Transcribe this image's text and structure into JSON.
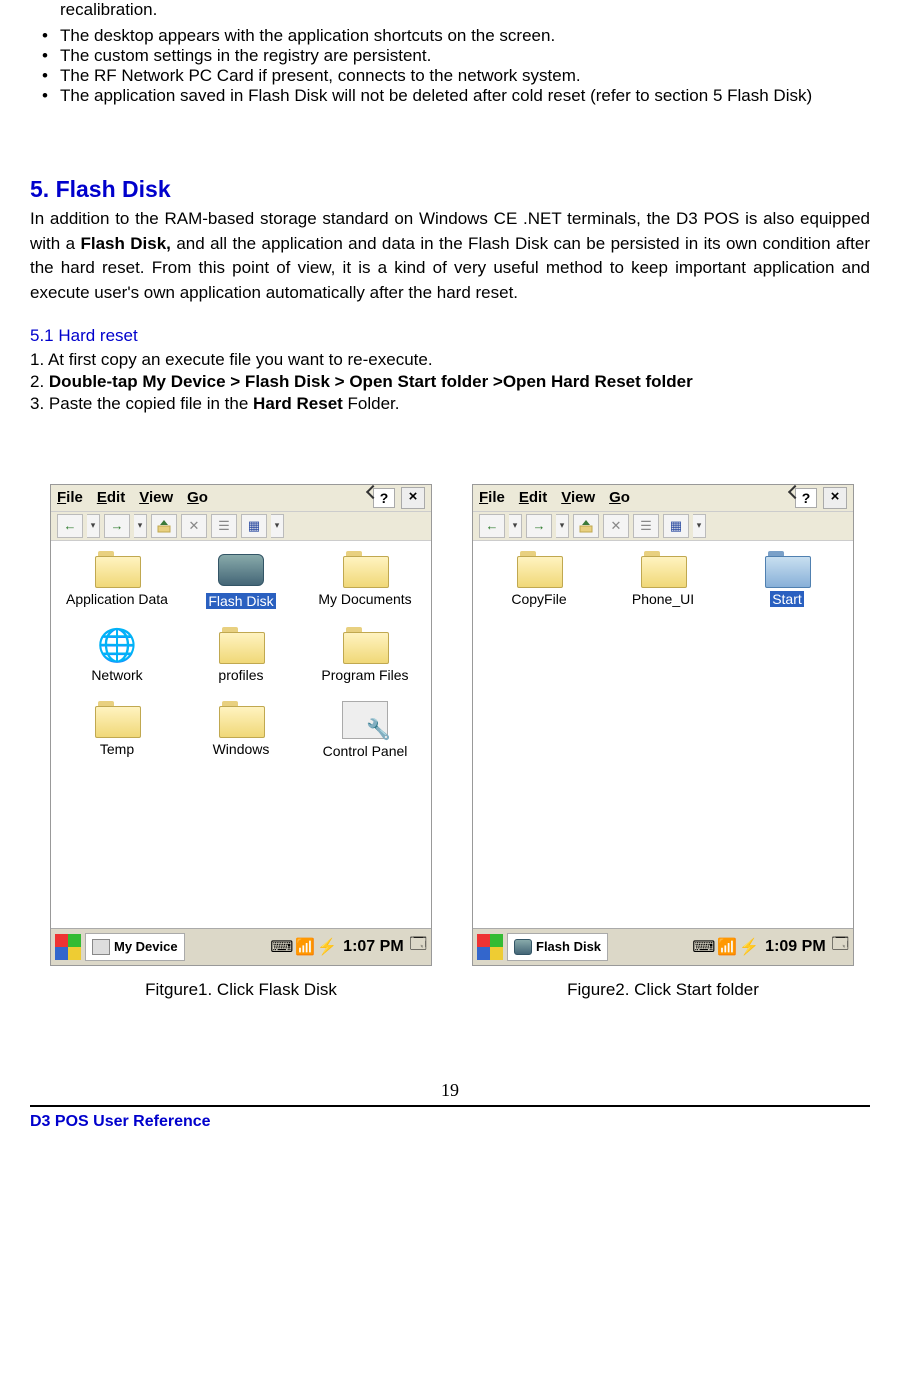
{
  "top_partial": "recalibration.",
  "bullets": [
    "The desktop appears with the application shortcuts on the screen.",
    "The custom settings in the registry are persistent.",
    "The RF Network PC Card if present, connects to the network system.",
    "The application saved in Flash Disk will not be deleted after cold reset (refer to section 5 Flash Disk)"
  ],
  "section_heading": "5. Flash Disk",
  "section_body_pre": "In addition to the RAM-based storage standard on Windows CE .NET terminals, the D3 POS is also equipped with a ",
  "section_body_bold": "Flash Disk,",
  "section_body_post": " and all the application and data in the Flash Disk can be persisted in its own condition after the hard reset. From this point of view, it is a kind of very useful method to keep important application and execute user's own application automatically after the hard reset.",
  "sub_heading": "5.1 Hard reset",
  "steps": {
    "s1": "1. At first copy an execute file you want to re-execute.",
    "s2_pre": "2. ",
    "s2_bold": "Double-tap My Device > Flash Disk > Open Start folder >Open Hard Reset folder",
    "s3_pre": "3. Paste the copied file in the ",
    "s3_bold": "Hard Reset",
    "s3_post": " Folder."
  },
  "menus": {
    "file": "File",
    "edit": "Edit",
    "view": "View",
    "go": "Go"
  },
  "close_x": "×",
  "help_q": "?",
  "explorer1": {
    "items": [
      {
        "name": "Application Data",
        "type": "folder"
      },
      {
        "name": "Flash Disk",
        "type": "disk",
        "selected": true
      },
      {
        "name": "My Documents",
        "type": "folder"
      },
      {
        "name": "Network",
        "type": "net"
      },
      {
        "name": "profiles",
        "type": "folder"
      },
      {
        "name": "Program Files",
        "type": "folder"
      },
      {
        "name": "Temp",
        "type": "folder"
      },
      {
        "name": "Windows",
        "type": "folder"
      },
      {
        "name": "Control Panel",
        "type": "ctrl"
      }
    ],
    "location": "My Device",
    "time": "1:07 PM"
  },
  "explorer2": {
    "items": [
      {
        "name": "CopyFile",
        "type": "folder"
      },
      {
        "name": "Phone_UI",
        "type": "folder"
      },
      {
        "name": "Start",
        "type": "start",
        "selected": true
      }
    ],
    "location": "Flash Disk",
    "time": "1:09 PM"
  },
  "captions": {
    "c1": "Fitgure1. Click Flask Disk",
    "c2": "Figure2. Click Start folder"
  },
  "page_num": "19",
  "footer": "D3 POS User Reference"
}
